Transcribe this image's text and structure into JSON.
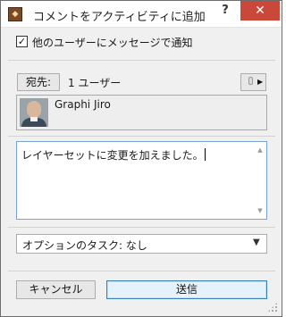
{
  "window": {
    "title": "コメントをアクティビティに追加",
    "help_label": "?",
    "close_label": "✕"
  },
  "notify": {
    "checked": true,
    "check_mark": "✓",
    "label": "他のユーザーにメッセージで通知"
  },
  "recipients": {
    "to_label": "宛先:",
    "count_label": "1 ユーザー",
    "users": [
      {
        "name": "Graphi Jiro"
      }
    ]
  },
  "message": {
    "value": "レイヤーセットに変更を加えました。"
  },
  "task": {
    "selected": "オプションのタスク: なし"
  },
  "footer": {
    "cancel_label": "キャンセル",
    "send_label": "送信"
  },
  "colors": {
    "close_button": "#c94839",
    "focus_border": "#7aa3d3",
    "default_button_border": "#3c7fb1"
  }
}
